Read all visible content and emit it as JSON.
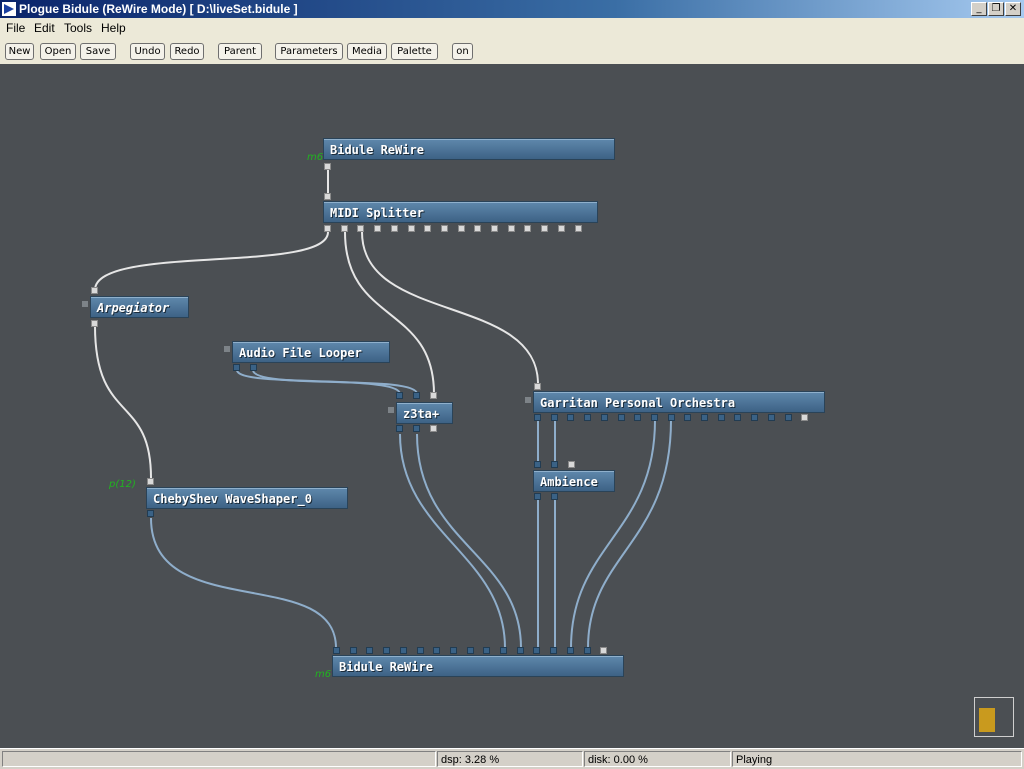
{
  "window": {
    "title": "Plogue Bidule (ReWire Mode) [ D:\\liveSet.bidule ]",
    "minimize_glyph": "_",
    "restore_glyph": "❐",
    "close_glyph": "✕"
  },
  "menu": [
    "File",
    "Edit",
    "Tools",
    "Help"
  ],
  "toolbar": {
    "new": "New",
    "open": "Open",
    "save": "Save",
    "undo": "Undo",
    "redo": "Redo",
    "parent": "Parent",
    "parameters": "Parameters",
    "media": "Media",
    "palette": "Palette",
    "on": "on"
  },
  "nodes": {
    "rewire_in": "Bidule ReWire",
    "midi_splitter": "MIDI Splitter",
    "arpegiator": "Arpegiator",
    "audio_file_looper": "Audio File Looper",
    "z3ta": "z3ta+",
    "garritan": "Garritan Personal Orchestra",
    "ambience": "Ambience",
    "chebyshev": "ChebyShev WaveShaper_0",
    "rewire_out": "Bidule ReWire"
  },
  "tags": {
    "rewire_in": "m6",
    "chebyshev": "p(12)",
    "rewire_out": "m6"
  },
  "status": {
    "dsp": "dsp:  3.28 %",
    "disk": "disk:  0.00 %",
    "state": "Playing"
  },
  "cpu_meter_level": 0.75,
  "colors": {
    "canvas": "#4b4f53",
    "node": "#4f769a",
    "audio_cable": "#88a8c8",
    "midi_cable": "#e8e8e8",
    "tag": "#21b321",
    "meter": "#c99a1e"
  }
}
